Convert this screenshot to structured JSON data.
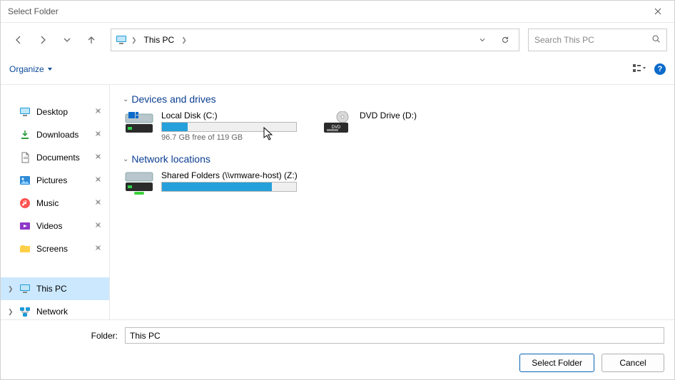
{
  "window": {
    "title": "Select Folder"
  },
  "address": {
    "location": "This PC"
  },
  "search": {
    "placeholder": "Search This PC"
  },
  "toolbar": {
    "organize_label": "Organize"
  },
  "sidebar": {
    "quick": [
      {
        "label": "Desktop",
        "icon": "desktop"
      },
      {
        "label": "Downloads",
        "icon": "download"
      },
      {
        "label": "Documents",
        "icon": "document"
      },
      {
        "label": "Pictures",
        "icon": "picture"
      },
      {
        "label": "Music",
        "icon": "music"
      },
      {
        "label": "Videos",
        "icon": "video"
      },
      {
        "label": "Screens",
        "icon": "folder"
      }
    ],
    "locations": [
      {
        "label": "This PC",
        "icon": "monitor",
        "selected": true
      },
      {
        "label": "Network",
        "icon": "network"
      }
    ]
  },
  "content": {
    "sections": [
      {
        "title": "Devices and drives",
        "items": [
          {
            "name": "Local Disk (C:)",
            "free_text": "96.7 GB free of 119 GB",
            "fill_percent": 19,
            "kind": "hdd"
          },
          {
            "name": "DVD Drive (D:)",
            "kind": "dvd"
          }
        ]
      },
      {
        "title": "Network locations",
        "items": [
          {
            "name": "Shared Folders (\\\\vmware-host) (Z:)",
            "fill_percent": 82,
            "kind": "netdrive"
          }
        ]
      }
    ]
  },
  "bottom": {
    "folder_label": "Folder:",
    "folder_value": "This PC",
    "select_label": "Select Folder",
    "cancel_label": "Cancel"
  }
}
